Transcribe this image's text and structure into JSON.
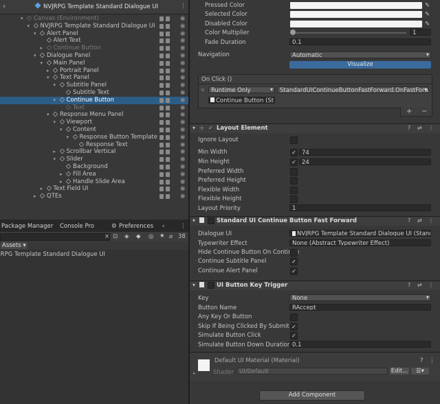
{
  "hierarchy": {
    "title": "NVJRPG Template Standard Dialogue UI",
    "rows": [
      {
        "label": "Canvas (Environment)",
        "dim": true,
        "indent": 0,
        "arrow": "▾"
      },
      {
        "label": "NVJRPG Template Standard Dialogue UI",
        "indent": 1,
        "arrow": "▾"
      },
      {
        "label": "Alert Panel",
        "indent": 2,
        "arrow": "▾"
      },
      {
        "label": "Alert Text",
        "indent": 3,
        "arrow": ""
      },
      {
        "label": "Continue Button",
        "dim": true,
        "indent": 3,
        "arrow": "▸"
      },
      {
        "label": "Dialogue Panel",
        "indent": 2,
        "arrow": "▾"
      },
      {
        "label": "Main Panel",
        "indent": 3,
        "arrow": "▾"
      },
      {
        "label": "Portrait Panel",
        "indent": 4,
        "arrow": "▸"
      },
      {
        "label": "Text Panel",
        "indent": 4,
        "arrow": "▾"
      },
      {
        "label": "Subtitle Panel",
        "indent": 5,
        "arrow": "▾"
      },
      {
        "label": "Subtitle Text",
        "indent": 6,
        "arrow": ""
      },
      {
        "label": "Continue Button",
        "indent": 5,
        "arrow": "▾",
        "selected": true
      },
      {
        "label": "Text",
        "dim": true,
        "indent": 6,
        "arrow": ""
      },
      {
        "label": "Response Menu Panel",
        "indent": 4,
        "arrow": "▾"
      },
      {
        "label": "Viewport",
        "indent": 5,
        "arrow": "▾"
      },
      {
        "label": "Content",
        "indent": 6,
        "arrow": "▾"
      },
      {
        "label": "Response Button Template",
        "indent": 7,
        "arrow": "▾"
      },
      {
        "label": "Response Text",
        "indent": 8,
        "arrow": ""
      },
      {
        "label": "Scrollbar Vertical",
        "indent": 5,
        "arrow": "▸"
      },
      {
        "label": "Slider",
        "indent": 5,
        "arrow": "▾"
      },
      {
        "label": "Background",
        "indent": 6,
        "arrow": ""
      },
      {
        "label": "Fill Area",
        "indent": 6,
        "arrow": "▸"
      },
      {
        "label": "Handle Slide Area",
        "indent": 6,
        "arrow": "▸"
      },
      {
        "label": "Text Field UI",
        "indent": 3,
        "arrow": "▸"
      },
      {
        "label": "QTEs",
        "indent": 2,
        "arrow": "▸"
      }
    ]
  },
  "bottom_tabs": {
    "package_manager": "Package Manager",
    "console": "Console Pro",
    "preferences": "Preferences"
  },
  "project": {
    "assets_label": "Assets",
    "item": "NVJRPG Template Standard Dialogue UI",
    "badge_count": "38"
  },
  "inspector": {
    "color_block": {
      "pressed": "Pressed Color",
      "selected": "Selected Color",
      "disabled": "Disabled Color",
      "multiplier_label": "Color Multiplier",
      "multiplier_value": "1",
      "multiplier_level": 0,
      "fade_label": "Fade Duration",
      "fade_value": "0.1"
    },
    "navigation": {
      "label": "Navigation",
      "value": "Automatic",
      "visualize": "Visualize"
    },
    "on_click": {
      "label": "On Click ()",
      "runtime": "Runtime Only",
      "function": "StandardUIContinueButtonFastForward.OnFastForward",
      "object": "Continue Button (St",
      "plus": "+",
      "minus": "−"
    },
    "layout_element": {
      "title": "Layout Element",
      "ignore_layout": "Ignore Layout",
      "min_width_label": "Min Width",
      "min_width": "74",
      "min_height_label": "Min Height",
      "min_height": "24",
      "pref_width": "Preferred Width",
      "pref_height": "Preferred Height",
      "flex_width": "Flexible Width",
      "flex_height": "Flexible Height",
      "priority_label": "Layout Priority",
      "priority": "1"
    },
    "fast_forward": {
      "title": "Standard UI Continue Button Fast Forward",
      "dialogue_ui_label": "Dialogue UI",
      "dialogue_ui_value": "NVJRPG Template Standard Dialogue UI (Standa",
      "typewriter_label": "Typewriter Effect",
      "typewriter_value": "None (Abstract Typewriter Effect)",
      "hide_label": "Hide Continue Button On Continue",
      "continue_subtitle": "Continue Subtitle Panel",
      "continue_alert": "Continue Alert Panel"
    },
    "key_trigger": {
      "title": "UI Button Key Trigger",
      "key_label": "Key",
      "key_value": "None",
      "button_name_label": "Button Name",
      "button_name_value": "RAccept",
      "any_key": "Any Key Or Button",
      "skip": "Skip If Being Clicked By Submit",
      "simulate": "Simulate Button Click",
      "duration_label": "Simulate Button Down Duration",
      "duration_value": "0.1"
    },
    "material": {
      "title": "Default UI Material (Material)",
      "shader_label": "Shader",
      "shader_value": "UI/Default",
      "edit": "Edit..."
    },
    "add_component": "Add Component"
  },
  "colors": {
    "selection": "#2c5d87",
    "accent": "#4a7fb5"
  }
}
